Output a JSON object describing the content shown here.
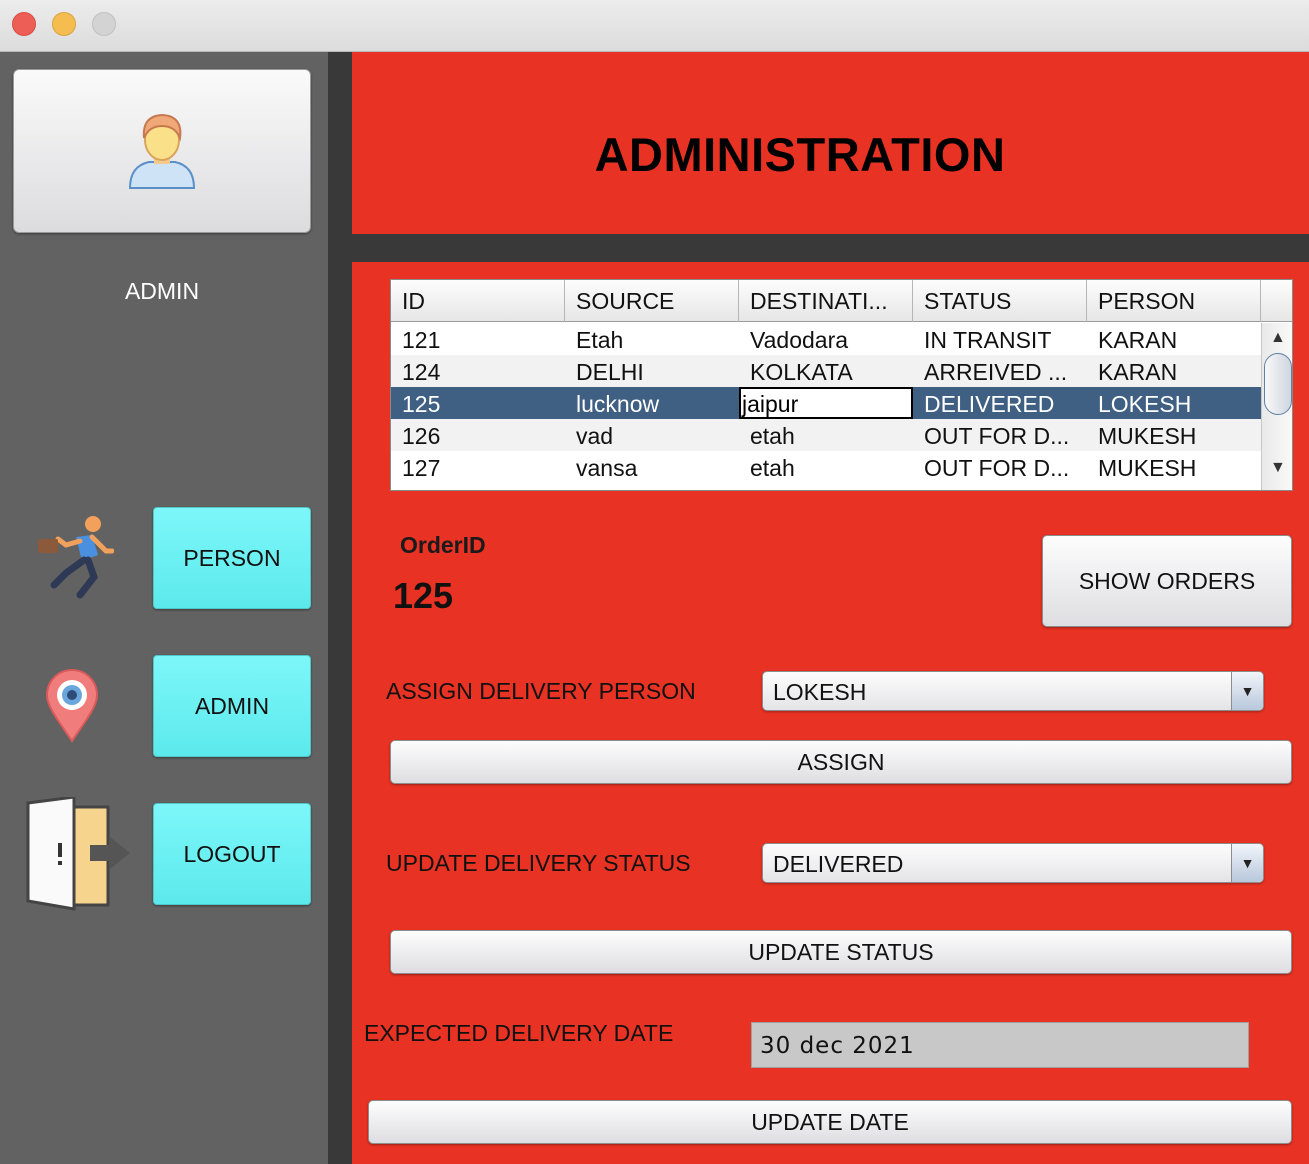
{
  "window": {
    "controls": [
      "close",
      "minimize",
      "maximize"
    ]
  },
  "sidebar": {
    "avatar_icon": "user-avatar-icon",
    "role": "ADMIN",
    "nav": [
      {
        "icon": "running-person-icon",
        "label": "PERSON"
      },
      {
        "icon": "map-pin-icon",
        "label": "ADMIN"
      },
      {
        "icon": "exit-door-icon",
        "label": "LOGOUT"
      }
    ]
  },
  "header": {
    "title": "ADMINISTRATION"
  },
  "table": {
    "columns": [
      "ID",
      "SOURCE",
      "DESTINATI...",
      "STATUS",
      "PERSON"
    ],
    "rows": [
      [
        "121",
        "Etah",
        "Vadodara",
        "IN TRANSIT",
        "KARAN"
      ],
      [
        "124",
        "DELHI",
        "KOLKATA",
        "ARREIVED ...",
        "KARAN"
      ],
      [
        "125",
        "lucknow",
        "jaipur",
        "DELIVERED",
        "LOKESH"
      ],
      [
        "126",
        "vad",
        "etah",
        "OUT FOR D...",
        "MUKESH"
      ],
      [
        "127",
        "vansa",
        "etah",
        "OUT FOR D...",
        "MUKESH"
      ]
    ],
    "selected_row": 2
  },
  "order": {
    "label": "OrderID",
    "value": "125"
  },
  "buttons": {
    "show_orders": "SHOW ORDERS",
    "assign": "ASSIGN",
    "update_status": "UPDATE STATUS",
    "update_date": "UPDATE DATE"
  },
  "assign": {
    "label": "ASSIGN DELIVERY PERSON",
    "selected": "LOKESH"
  },
  "status": {
    "label": "UPDATE DELIVERY STATUS",
    "selected": "DELIVERED"
  },
  "date": {
    "label": "EXPECTED DELIVERY DATE",
    "value": "30 dec 2021"
  },
  "colors": {
    "accent_red": "#e83223",
    "sidebar": "#626262",
    "nav_button": "#6ef2f4",
    "selection": "#3f5f83"
  }
}
